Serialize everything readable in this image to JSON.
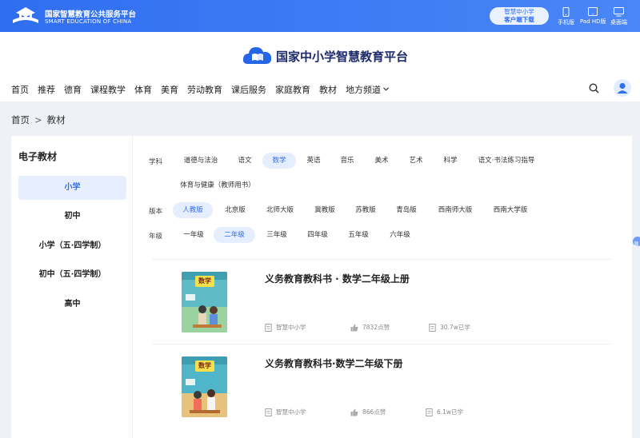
{
  "topbar": {
    "title": "国家智慧教育公共服务平台",
    "subtitle": "SMART EDUCATION OF CHINA",
    "download_line1": "智慧中小学",
    "download_line2": "客户端下载",
    "devices": [
      {
        "label": "手机版",
        "icon": "phone-icon"
      },
      {
        "label": "Pad HD版",
        "icon": "tablet-icon"
      },
      {
        "label": "桌面端",
        "icon": "monitor-icon"
      }
    ]
  },
  "brand": {
    "name": "国家中小学智慧教育平台"
  },
  "nav": {
    "items": [
      "首页",
      "推荐",
      "德育",
      "课程教学",
      "体育",
      "美育",
      "劳动教育",
      "课后服务",
      "家庭教育",
      "教材",
      "地方频道"
    ]
  },
  "breadcrumb": {
    "home": "首页",
    "sep": ">",
    "current": "教材"
  },
  "sidebar": {
    "title": "电子教材",
    "items": [
      "小学",
      "初中",
      "小学（五·四学制）",
      "初中（五·四学制）",
      "高中"
    ],
    "active_index": 0
  },
  "filters": {
    "subject_label": "学科",
    "subjects": [
      "道德与法治",
      "语文",
      "数学",
      "英语",
      "音乐",
      "美术",
      "艺术",
      "科学",
      "语文·书法练习指导",
      "体育与健康（教师用书）"
    ],
    "subject_active": "数学",
    "edition_label": "版本",
    "editions": [
      "人教版",
      "北京版",
      "北师大版",
      "冀教版",
      "苏教版",
      "青岛版",
      "西南师大版",
      "西南大学版"
    ],
    "edition_active": "人教版",
    "grade_label": "年级",
    "grades": [
      "一年级",
      "二年级",
      "三年级",
      "四年级",
      "五年级",
      "六年级"
    ],
    "grade_active": "二年级"
  },
  "books": [
    {
      "title": "义务教育教科书 · 数学二年级上册",
      "cover_text": "数学",
      "publisher": "智慧中小学",
      "likes": "7832点赞",
      "learners": "30.7w已学"
    },
    {
      "title": "义务教育教科书·数学二年级下册",
      "cover_text": "数学",
      "publisher": "智慧中小学",
      "likes": "866点赞",
      "learners": "6.1w已学"
    }
  ],
  "colors": {
    "primary": "#2f6ef0",
    "active_bg": "#e5eeff",
    "page_bg": "#eef1f6"
  }
}
